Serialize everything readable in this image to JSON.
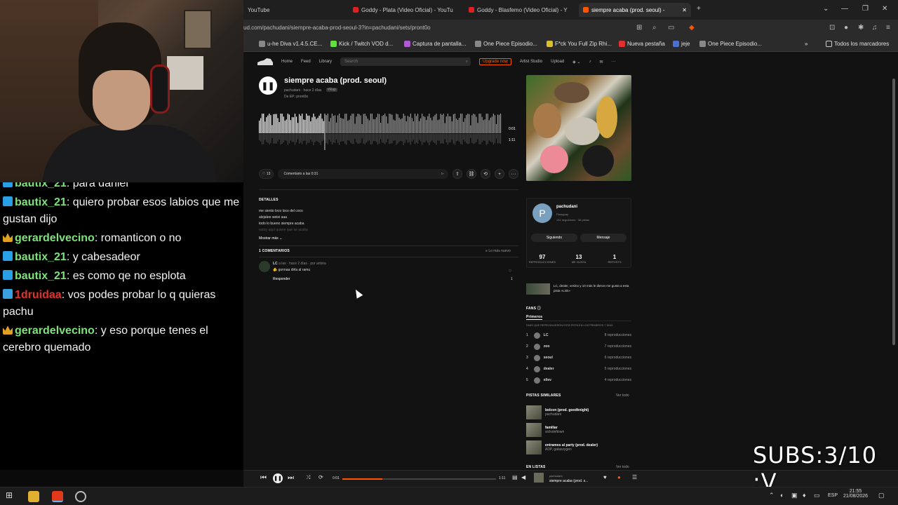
{
  "tabs": [
    {
      "label": "YouTube"
    },
    {
      "label": "Goddy - Plata (Video Oficial) - YouTu"
    },
    {
      "label": "Goddy - Blasfemo (Video Oficial) - Y"
    },
    {
      "label": "siempre acaba (prod. seoul) -"
    }
  ],
  "address": {
    "url": "ud.com/pachudani/siempre-acaba-prod-seoul-3?in=pachudani/sets/pront0o"
  },
  "bookmarks": [
    "u-he Diva v1.4.5.CE...",
    "Kick / Twitch VOD d...",
    "Captura de pantalla...",
    "One Piece Episodio...",
    "F*ck You Full Zip Rhi...",
    "Nueva pestaña",
    "jeje",
    "One Piece Episodio...",
    "Todos los marcadores"
  ],
  "chat": [
    {
      "user": "bautix_21",
      "text": ": para daniel",
      "badge": "cube",
      "color": "green"
    },
    {
      "user": "bautix_21",
      "text": ": quiero probar esos labios que me gustan dijo",
      "badge": "cube",
      "color": "green"
    },
    {
      "user": "gerardelvecino",
      "text": ": romanticon o no",
      "badge": "crown",
      "color": "green"
    },
    {
      "user": "bautix_21",
      "text": ": y cabesadeor",
      "badge": "cube",
      "color": "green"
    },
    {
      "user": "bautix_21",
      "text": ": es como qe no esplota",
      "badge": "cube",
      "color": "green"
    },
    {
      "user": "1druidaa",
      "text": ": vos podes probar lo q quieras pachu",
      "badge": "mod",
      "color": "red"
    },
    {
      "user": "gerardelvecino",
      "text": ": y eso porque tenes el cerebro quemado",
      "badge": "crown",
      "color": "green"
    }
  ],
  "sc_nav": {
    "home": "Home",
    "feed": "Feed",
    "library": "Library",
    "search_placeholder": "Search",
    "upgrade": "Upgrade now",
    "artist_studio": "Artist Studio",
    "upload": "Upload"
  },
  "track": {
    "title": "siempre acaba (prod. seoul)",
    "artist_line": "pachudani · hace 2 días",
    "tag": "#Rap",
    "ep_line": "De EP: pront0o",
    "time_current": "0:01",
    "time_total": "1:11",
    "likes": "13",
    "comment_placeholder": "Comentario a las 0:31"
  },
  "details": {
    "heading": "DETALLES",
    "lines": [
      "me siento loco loco del coco",
      "alejatee weiei aaa",
      "todo lo bueno siempre acaba",
      "estoy aquí quiere que se acaba"
    ],
    "show_more": "Mostrar más"
  },
  "comments": {
    "heading": "1 COMENTARIOS",
    "sort": "Lo más nuevo",
    "item_user": "LC",
    "item_meta": "a las · hace 2 días · por artista",
    "item_text": "🫵 gonnaa dirla al ramu",
    "reply": "Responder",
    "likes": "1"
  },
  "profile": {
    "initial": "P",
    "name": "pachudani",
    "location": "Paraguay",
    "followers": "131 seguidores · 36 pistas",
    "follow_btn": "Siguiendo",
    "message_btn": "Mensaje",
    "stats": [
      {
        "n": "97",
        "l": "REPRODUCCIONES"
      },
      {
        "n": "13",
        "l": "ME GUSTA"
      },
      {
        "n": "1",
        "l": "REPOSTS"
      }
    ]
  },
  "liked_by": "LC, dealer, vesino y 10 más le dieron me gusta a esta pista «Link»",
  "fans": {
    "heading": "FANS",
    "tab": "Primeros",
    "subheading": "FANS QUE REPRODUJERON ESTA PISTA EN LOS PRIMEROS 7 DÍAS",
    "items": [
      {
        "rank": "1",
        "name": "LC",
        "plays": "8 reproducciones"
      },
      {
        "rank": "2",
        "name": "zoo",
        "plays": "7 reproducciones"
      },
      {
        "rank": "3",
        "name": "seoul",
        "plays": "6 reproducciones"
      },
      {
        "rank": "4",
        "name": "dealer",
        "plays": "5 reproducciones"
      },
      {
        "rank": "5",
        "name": "ellev",
        "plays": "4 reproducciones"
      }
    ]
  },
  "similar": {
    "heading": "PISTAS SIMILARES",
    "see_all": "Ver todo",
    "items": [
      {
        "title": "bolcon (prod. goodknight)",
        "artist": "pachudani"
      },
      {
        "title": "familiar",
        "artist": "sickoleftown"
      },
      {
        "title": "entramos al party (prod. dealer)",
        "artist": "ADP, galaxzygen"
      }
    ]
  },
  "in_lists": {
    "heading": "EN LISTAS",
    "see_all": "Ver todo"
  },
  "player": {
    "current": "0:01",
    "total": "1:11",
    "progress": 0.26,
    "now_artist": "pachudani",
    "now_title": "siempre acaba (prod. s..."
  },
  "overlay": {
    "subs": "SUBS:3/10 :V"
  },
  "taskbar": {
    "lang": "ESP",
    "time": "21:55",
    "date": "21/08/2026"
  },
  "colors": {
    "accent": "#ff5500",
    "chat_green": "#7ee27a",
    "chat_red": "#e0322f"
  }
}
